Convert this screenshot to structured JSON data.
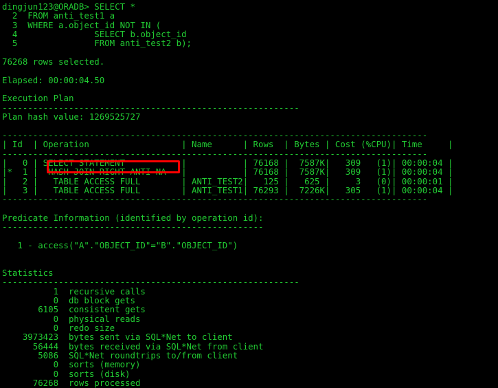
{
  "terminal": {
    "prompt": "dingjun123@ORADB> ",
    "colors": {
      "text": "#22cc33",
      "background": "#000000",
      "highlight": "#ff0000"
    },
    "query": {
      "line_1": "dingjun123@ORADB> SELECT *",
      "line_2": "  2  FROM anti_test1 a",
      "line_3": "  3  WHERE a.object_id NOT IN (",
      "line_4": "  4               SELECT b.object_id",
      "line_5": "  5               FROM anti_test2 b);"
    },
    "result": {
      "rows_selected": "76268 rows selected.",
      "elapsed": "Elapsed: 00:00:04.50"
    },
    "execution_plan": {
      "heading": "Execution Plan",
      "heading_separator": "----------------------------------------------------------",
      "plan_hash": "Plan hash value: 1269525727",
      "table_separator": "-----------------------------------------------------------------------------------",
      "header": "| Id  | Operation                  | Name      | Rows  | Bytes | Cost (%CPU)| Time     |",
      "rows": [
        "|   0 | SELECT STATEMENT           |           | 76168 |  7587K|   309   (1)| 00:00:04 |",
        "|*  1 |  HASH JOIN RIGHT ANTI NA   |           | 76168 |  7587K|   309   (1)| 00:00:04 |",
        "|   2 |   TABLE ACCESS FULL        | ANTI_TEST2|   125 |   625 |     3   (0)| 00:00:01 |",
        "|   3 |   TABLE ACCESS FULL        | ANTI_TEST1| 76293 |  7226K|   305   (1)| 00:00:04 |"
      ],
      "highlighted_operation": "HASH JOIN RIGHT ANTI NA"
    },
    "predicate_information": {
      "heading": "Predicate Information (identified by operation id):",
      "separator": "---------------------------------------------------",
      "entries": [
        "   1 - access(\"A\".\"OBJECT_ID\"=\"B\".\"OBJECT_ID\")"
      ]
    },
    "statistics": {
      "heading": "Statistics",
      "separator": "----------------------------------------------------------",
      "entries": [
        "          1  recursive calls",
        "          0  db block gets",
        "       6105  consistent gets",
        "          0  physical reads",
        "          0  redo size",
        "    3973423  bytes sent via SQL*Net to client",
        "      56444  bytes received via SQL*Net from client",
        "       5086  SQL*Net roundtrips to/from client",
        "          0  sorts (memory)",
        "          0  sorts (disk)",
        "      76268  rows processed"
      ]
    }
  }
}
